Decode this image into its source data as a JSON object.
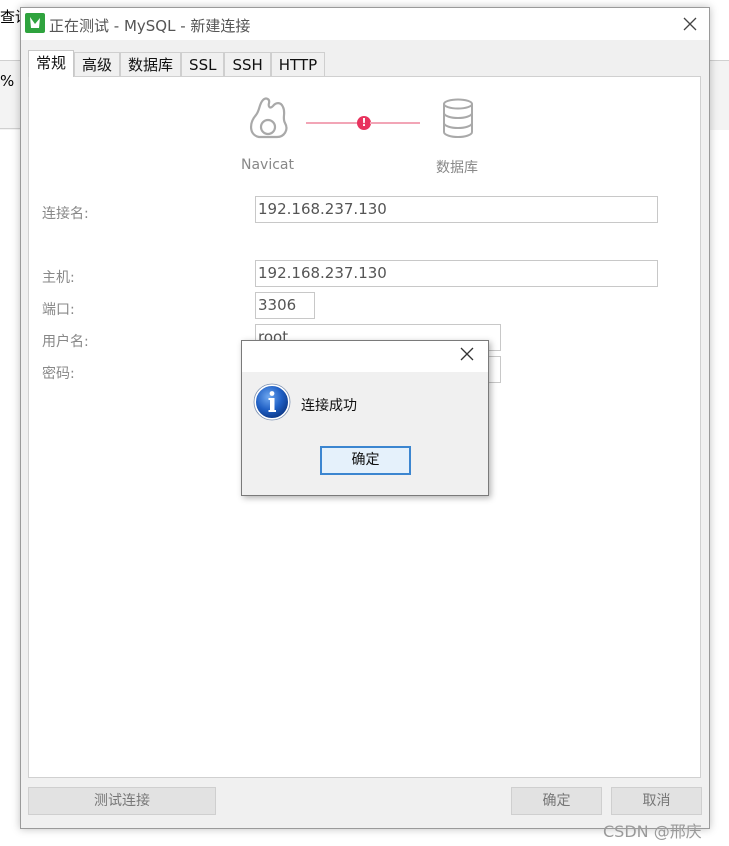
{
  "background": {
    "menu_fragment": "查询",
    "toolbar_fragment": "% SC"
  },
  "window": {
    "title": "正在测试 - MySQL - 新建连接",
    "tabs": [
      "常规",
      "高级",
      "数据库",
      "SSL",
      "SSH",
      "HTTP"
    ],
    "active_tab": "常规"
  },
  "flow": {
    "left_label": "Navicat",
    "right_label": "数据库",
    "status_mark": "!",
    "status_color": "#e8335e",
    "line_color": "#f2a5b6"
  },
  "form": {
    "connection_name_label": "连接名:",
    "connection_name_value": "192.168.237.130",
    "host_label": "主机:",
    "host_value": "192.168.237.130",
    "port_label": "端口:",
    "port_value": "3306",
    "username_label": "用户名:",
    "username_value": "root",
    "password_label": "密码:"
  },
  "buttons": {
    "test_connection": "测试连接",
    "ok": "确定",
    "cancel": "取消"
  },
  "message_box": {
    "text": "连接成功",
    "ok": "确定",
    "icon": "info-icon"
  },
  "watermark": "CSDN @邢庆"
}
